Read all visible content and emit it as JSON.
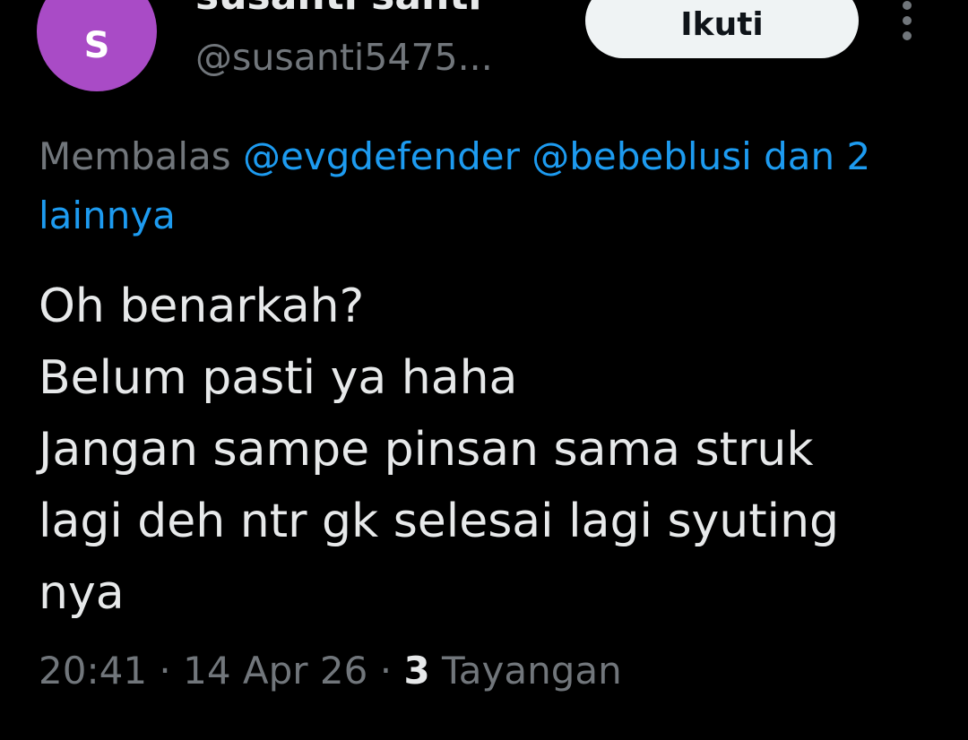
{
  "author": {
    "avatar_letter": "S",
    "avatar_color": "#a94bc6",
    "display_name": "susanti santi",
    "handle": "@susanti5475..."
  },
  "actions": {
    "follow_label": "Ikuti",
    "more_icon": "more-vertical-icon"
  },
  "reply": {
    "prefix": "Membalas ",
    "mention_1": "@evgdefender",
    "mention_2": "@bebeblusi",
    "others": "dan 2 lainnya"
  },
  "tweet": {
    "lines": [
      "Oh benarkah?",
      "Belum pasti ya haha",
      "Jangan sampe pinsan sama struk",
      "lagi deh ntr gk selesai lagi syuting",
      "nya"
    ]
  },
  "meta": {
    "time": "20:41",
    "separator": "·",
    "date": "14 Apr 26",
    "views_count": "3",
    "views_label": "Tayangan"
  },
  "colors": {
    "background": "#000000",
    "text_primary": "#e7e9ea",
    "text_secondary": "#71767b",
    "link": "#1d9bf0",
    "button_bg": "#eff3f4"
  }
}
